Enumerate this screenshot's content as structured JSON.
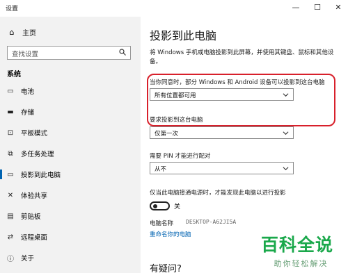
{
  "window": {
    "title": "设置",
    "minimize_glyph": "—",
    "maximize_glyph": "☐",
    "close_glyph": "✕"
  },
  "sidebar": {
    "home": {
      "label": "主页",
      "icon": "home-icon"
    },
    "search": {
      "placeholder": "查找设置",
      "icon": "search-icon"
    },
    "section": "系统",
    "items": [
      {
        "label": "电池",
        "icon": "battery-icon"
      },
      {
        "label": "存储",
        "icon": "storage-icon"
      },
      {
        "label": "平板模式",
        "icon": "tablet-icon"
      },
      {
        "label": "多任务处理",
        "icon": "multitask-icon"
      },
      {
        "label": "投影到此电脑",
        "icon": "projector-icon",
        "active": true
      },
      {
        "label": "体验共享",
        "icon": "share-icon"
      },
      {
        "label": "剪贴板",
        "icon": "clipboard-icon"
      },
      {
        "label": "远程桌面",
        "icon": "remote-desktop-icon"
      },
      {
        "label": "关于",
        "icon": "info-icon"
      }
    ]
  },
  "main": {
    "title": "投影到此电脑",
    "description": "将 Windows 手机或电脑投影到此屏幕，并使用其键盘、鼠标和其他设备。",
    "setting1": {
      "label": "当你同意时，部分 Windows 和 Android 设备可以投影到这台电脑",
      "value": "所有位置都可用"
    },
    "setting2": {
      "label": "要求投影到这台电脑",
      "value": "仅第一次"
    },
    "setting3": {
      "label": "需要 PIN 才能进行配对",
      "value": "从不"
    },
    "setting4": {
      "label": "仅当此电脑接通电源时，才能发现此电脑以进行投影",
      "toggle_state": "关",
      "toggle_on": false
    },
    "pc_name_label": "电脑名称",
    "pc_name_value": "DESKTOP-A62JI5A",
    "rename_link": "重命名你的电脑",
    "faq_heading": "有疑问?"
  },
  "watermark": {
    "logo": "百科全说",
    "sub": "助你轻松解决",
    "color": "#1aa84b"
  },
  "colors": {
    "accent": "#0063b1",
    "highlight": "#d8202b",
    "sidebar_bg": "#f2f2f2"
  }
}
